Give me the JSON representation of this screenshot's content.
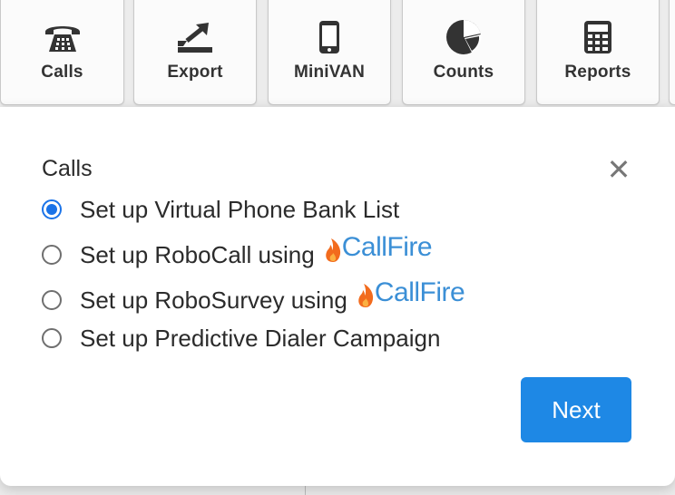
{
  "toolbar": {
    "items": [
      {
        "label": "Calls",
        "icon": "phone-icon"
      },
      {
        "label": "Export",
        "icon": "export-icon"
      },
      {
        "label": "MiniVAN",
        "icon": "mobile-icon"
      },
      {
        "label": "Counts",
        "icon": "pie-chart-icon"
      },
      {
        "label": "Reports",
        "icon": "calculator-icon"
      }
    ]
  },
  "modal": {
    "title": "Calls",
    "close_icon": "close-icon",
    "options": [
      {
        "label": "Set up Virtual Phone Bank List",
        "selected": true,
        "brand": null
      },
      {
        "label": "Set up RoboCall using",
        "selected": false,
        "brand": "CallFire"
      },
      {
        "label": "Set up RoboSurvey using",
        "selected": false,
        "brand": "CallFire"
      },
      {
        "label": "Set up Predictive Dialer Campaign",
        "selected": false,
        "brand": null
      }
    ],
    "next_label": "Next"
  },
  "colors": {
    "accent": "#1e88e5",
    "radio_selected": "#1a73e8",
    "callfire_blue": "#3b8fd6",
    "callfire_flame": "#f26b1d"
  }
}
